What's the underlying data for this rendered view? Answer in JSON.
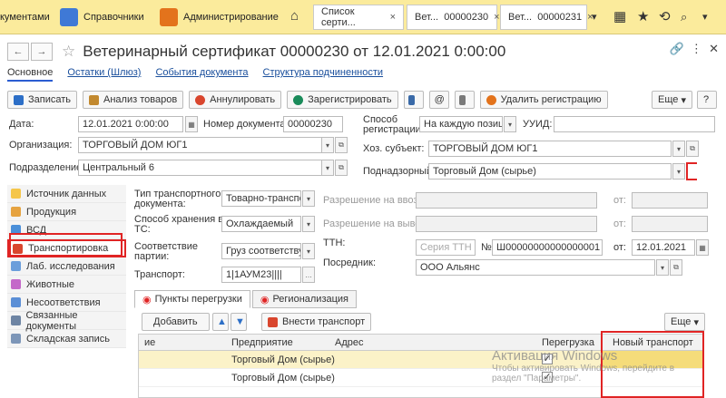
{
  "topbar": {
    "sections": [
      {
        "label": "кументами",
        "color": "#2d6fc7"
      },
      {
        "label": "Справочники",
        "color": "#3f79d6"
      },
      {
        "label": "Администрирование",
        "color": "#e3731c"
      }
    ],
    "tabs": [
      {
        "label": "Список серти..."
      },
      {
        "label": "Вет...",
        "num": "00000230"
      },
      {
        "label": "Вет...",
        "num": "00000231"
      }
    ]
  },
  "doc": {
    "title": "Ветеринарный сертификат 00000230 от 12.01.2021 0:00:00",
    "sublinks": [
      "Основное",
      "Остатки (Шлюз)",
      "События документа",
      "Структура подчиненности"
    ]
  },
  "toolbar": {
    "write": "Записать",
    "analysis": "Анализ товаров",
    "cancel": "Аннулировать",
    "register": "Зарегистрировать",
    "del_reg": "Удалить регистрацию",
    "more": "Еще",
    "help": "?"
  },
  "form": {
    "date_label": "Дата:",
    "date_value": "12.01.2021  0:00:00",
    "docnum_label": "Номер документа:",
    "docnum_value": "00000230",
    "method_label1": "Способ",
    "method_label2": "регистрации:",
    "method_value": "На каждую позици",
    "uuid_label": "УУИД:",
    "org_label": "Организация:",
    "org_value": "ТОРГОВЫЙ ДОМ ЮГ1",
    "hoz_label": "Хоз. субъект:",
    "hoz_value": "ТОРГОВЫЙ ДОМ ЮГ1",
    "div_label": "Подразделение:",
    "div_value": "Центральный 6",
    "podn_label": "Поднадзорный:",
    "podn_value": "Торговый Дом (сырье)"
  },
  "left_panel": [
    {
      "label": "Источник данных",
      "color": "#f5c64a"
    },
    {
      "label": "Продукция",
      "color": "#e6a340"
    },
    {
      "label": "ВСД",
      "color": "#4a8fd9"
    },
    {
      "label": "Транспортировка",
      "color": "#d9462e"
    },
    {
      "label": "Лаб. исследования",
      "color": "#6b9edb"
    },
    {
      "label": "Животные",
      "color": "#c468c9"
    },
    {
      "label": "Несоответствия",
      "color": "#5b8fd6"
    },
    {
      "label": "Связанные документы",
      "color": "#6d84a3"
    },
    {
      "label": "Складская запись",
      "color": "#7d96b8"
    }
  ],
  "transport": {
    "type_label1": "Тип транспортного",
    "type_label2": "документа:",
    "type_value": "Товарно-транспорт",
    "storage_label1": "Способ хранения в",
    "storage_label2": "ТС:",
    "storage_value": "Охлаждаемый",
    "match_label1": "Соответствие",
    "match_label2": "партии:",
    "match_value": "Груз соответствует",
    "vehicle_label": "Транспорт:",
    "vehicle_value": "1|1АУМ23||||",
    "import_label": "Разрешение на ввоз:",
    "export_label": "Разрешение на вывоз:",
    "from_label": "от:",
    "ttn_label": "ТТН:",
    "ttn_series": "Серия ТТН",
    "ttn_num_label": "№:",
    "ttn_number": "Ш00000000000000001",
    "ttn_from": "от:",
    "ttn_date": "12.01.2021",
    "agent_label": "Посредник:",
    "agent_value": "ООО  Альянс"
  },
  "subtabs": [
    "Пункты перегрузки",
    "Регионализация"
  ],
  "grid_toolbar": {
    "add": "Добавить",
    "insert": "Внести транспорт",
    "more": "Еще"
  },
  "grid": {
    "headers": [
      "ие",
      "Предприятие",
      "Адрес",
      "Перегрузка",
      "Новый транспорт"
    ],
    "rows": [
      {
        "enterprise": "Торговый Дом (сырье)",
        "checked": "✓"
      },
      {
        "enterprise": "Торговый Дом (сырье)",
        "checked": "✓"
      }
    ]
  },
  "watermark": {
    "line1": "Активация Windows",
    "line2": "Чтобы активировать Windows, перейдите в",
    "line3": "раздел \"Параметры\"."
  }
}
